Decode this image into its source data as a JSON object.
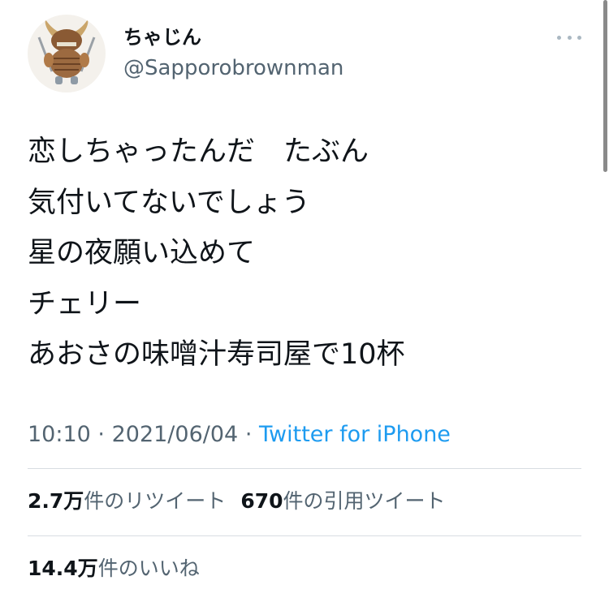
{
  "author": {
    "display_name": "ちゃじん",
    "handle": "@Sapporobrownman",
    "avatar": "armored-monster-avatar"
  },
  "icons": {
    "more": "more-options-icon"
  },
  "tweet": {
    "lines": [
      "恋しちゃったんだ　たぶん",
      "気付いてないでしょう",
      "星の夜願い込めて",
      "チェリー",
      "あおさの味噌汁寿司屋で10杯"
    ]
  },
  "meta": {
    "time": "10:10",
    "separator": "·",
    "date": "2021/06/04",
    "source": "Twitter for iPhone"
  },
  "stats": {
    "retweets_count": "2.7万",
    "retweets_label": "件のリツイート",
    "quotes_count": "670",
    "quotes_label": "件の引用ツイート",
    "likes_count": "14.4万",
    "likes_label": "件のいいね"
  },
  "colors": {
    "text": "#0f1419",
    "secondary": "#536471",
    "link": "#1d9bf0",
    "divider": "#d8dde2"
  }
}
